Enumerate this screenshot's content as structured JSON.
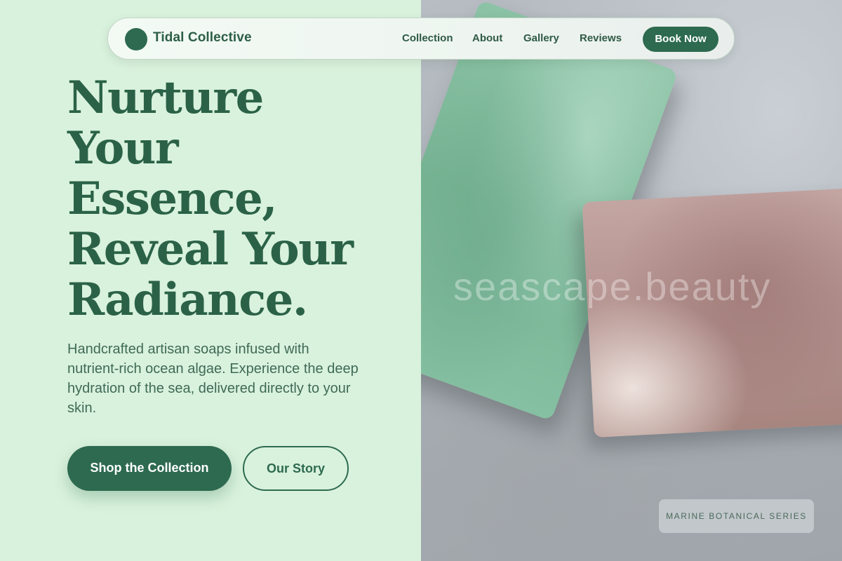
{
  "brand": {
    "name": "Tidal Collective",
    "accent": "#2d6a4f",
    "background": "#d9f2dd"
  },
  "nav": {
    "links": [
      "Collection",
      "About",
      "Gallery",
      "Reviews"
    ],
    "cta": "Book Now"
  },
  "hero": {
    "headline_lines": [
      "Nurture",
      "Your",
      "Essence,",
      "Reveal Your",
      "Radiance."
    ],
    "subcopy": "Handcrafted artisan soaps infused with nutrient-rich ocean algae. Experience the deep hydration of the sea, delivered directly to your skin.",
    "primary_cta": "Shop the Collection",
    "secondary_cta": "Our Story"
  },
  "image": {
    "watermark": "seascape.beauty",
    "badge": "MARINE BOTANICAL SERIES"
  }
}
